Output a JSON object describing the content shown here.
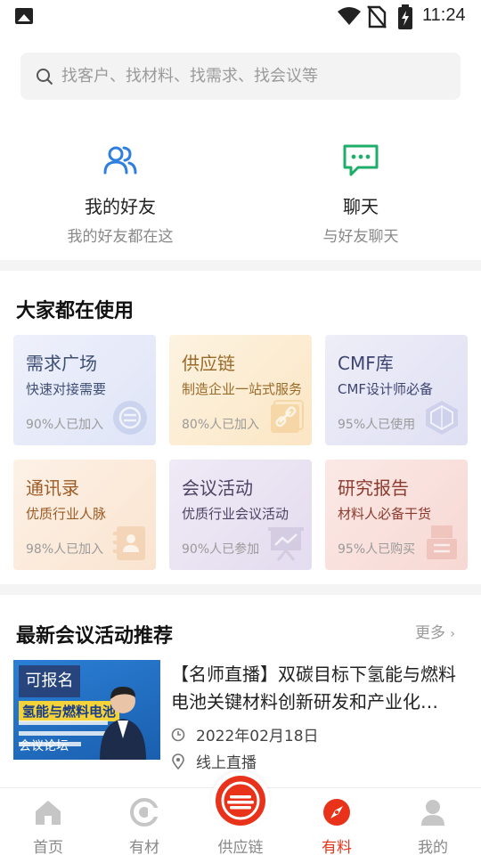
{
  "status_bar": {
    "time": "11:24"
  },
  "search": {
    "placeholder": "找客户、找材料、找需求、找会议等"
  },
  "quick_links": [
    {
      "title": "我的好友",
      "subtitle": "我的好友都在这",
      "icon": "friends-icon",
      "color": "#2e7fe0"
    },
    {
      "title": "聊天",
      "subtitle": "与好友聊天",
      "icon": "chat-icon",
      "color": "#1fae6a"
    }
  ],
  "popular": {
    "title": "大家都在使用",
    "cards": [
      {
        "title": "需求广场",
        "subtitle": "快速对接需要",
        "stat": "90%人已加入",
        "icon": "demand-icon"
      },
      {
        "title": "供应链",
        "subtitle": "制造企业一站式服务",
        "stat": "80%人已加入",
        "icon": "link-icon"
      },
      {
        "title": "CMF库",
        "subtitle": "CMF设计师必备",
        "stat": "95%人已使用",
        "icon": "gem-icon"
      },
      {
        "title": "通讯录",
        "subtitle": "优质行业人脉",
        "stat": "98%人已加入",
        "icon": "contacts-icon"
      },
      {
        "title": "会议活动",
        "subtitle": "优质行业会议活动",
        "stat": "90%人已参加",
        "icon": "presentation-icon"
      },
      {
        "title": "研究报告",
        "subtitle": "材料人必备干货",
        "stat": "95%人已购买",
        "icon": "report-icon"
      }
    ]
  },
  "events": {
    "title": "最新会议活动推荐",
    "more": "更多",
    "items": [
      {
        "badge": "可报名",
        "thumb_heading": "氢能与燃料电池",
        "thumb_footer": "会议论坛",
        "title": "【名师直播】双碳目标下氢能与燃料电池关键材料创新研发和产业化…",
        "date": "2022年02月18日",
        "location": "线上直播"
      }
    ]
  },
  "tabbar": {
    "items": [
      {
        "label": "首页",
        "icon": "home-icon",
        "active": false
      },
      {
        "label": "有材",
        "icon": "material-icon",
        "active": false
      },
      {
        "label": "供应链",
        "icon": "supply-chain-icon",
        "active": false
      },
      {
        "label": "有料",
        "icon": "compass-icon",
        "active": true
      },
      {
        "label": "我的",
        "icon": "profile-icon",
        "active": false
      }
    ],
    "active_color": "#e8321a"
  }
}
